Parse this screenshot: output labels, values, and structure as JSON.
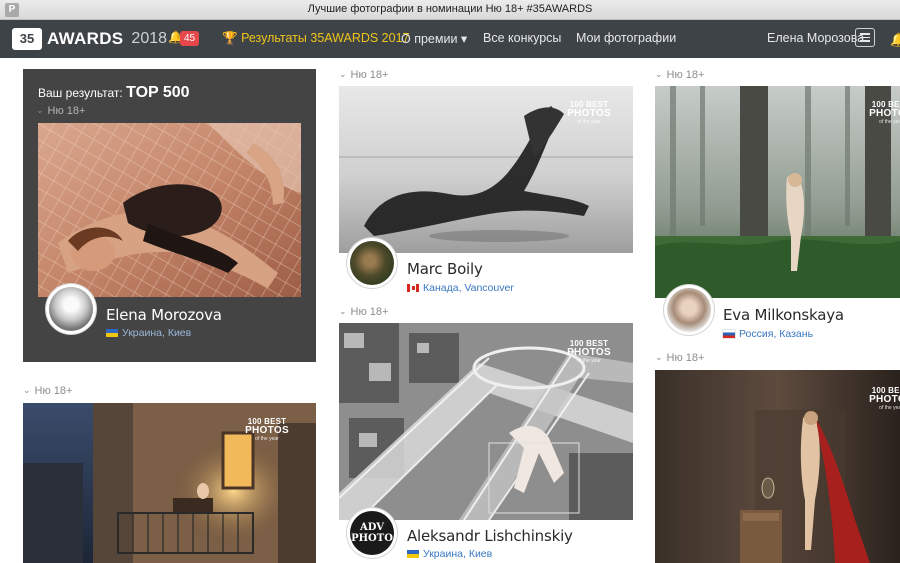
{
  "window": {
    "title": "Лучшие фотографии в номинации Ню 18+ #35AWARDS",
    "app_icon": "P"
  },
  "navbar": {
    "logo_badge": "35",
    "brand": "AWARDS",
    "year": "2018",
    "notifications_count": "45",
    "items": [
      {
        "label": "Результаты 35AWARDS 2017",
        "highlight": true
      },
      {
        "label": "О премии ▾",
        "highlight": false
      },
      {
        "label": "Все конкурсы",
        "highlight": false
      },
      {
        "label": "Мои фотографии",
        "highlight": false
      }
    ],
    "user_name": "Елена Морозова",
    "colors": {
      "bg": "#3e4348",
      "accent": "#f0c419",
      "badge": "#e5474b"
    }
  },
  "award_badge": {
    "line1": "100 BEST",
    "line2": "PHOTOS",
    "line3": "of the year"
  },
  "result_card": {
    "label": "Ваш результат:",
    "rank": "TOP 500",
    "category": "Ню 18+",
    "author": {
      "name": "Elena Morozova",
      "country": "Украина",
      "city": "Киев",
      "flag": "ua"
    }
  },
  "entries": [
    {
      "category": "Ню 18+",
      "author": {
        "name": "Marc Boily",
        "country": "Канада",
        "city": "Vancouver",
        "flag": "ca"
      }
    },
    {
      "category": "Ню 18+",
      "author": {
        "name": "Eva Milkonskaya",
        "country": "Россия",
        "city": "Казань",
        "flag": "ru"
      }
    },
    {
      "category": "Ню 18+",
      "author": {
        "name": "Aleksandr Lishchinskiy",
        "country": "Украина",
        "city": "Киев",
        "flag": "ua",
        "avatar_text": "ADV PHOTO"
      }
    },
    {
      "category": "Ню 18+"
    },
    {
      "category": "Ню 18+"
    }
  ]
}
